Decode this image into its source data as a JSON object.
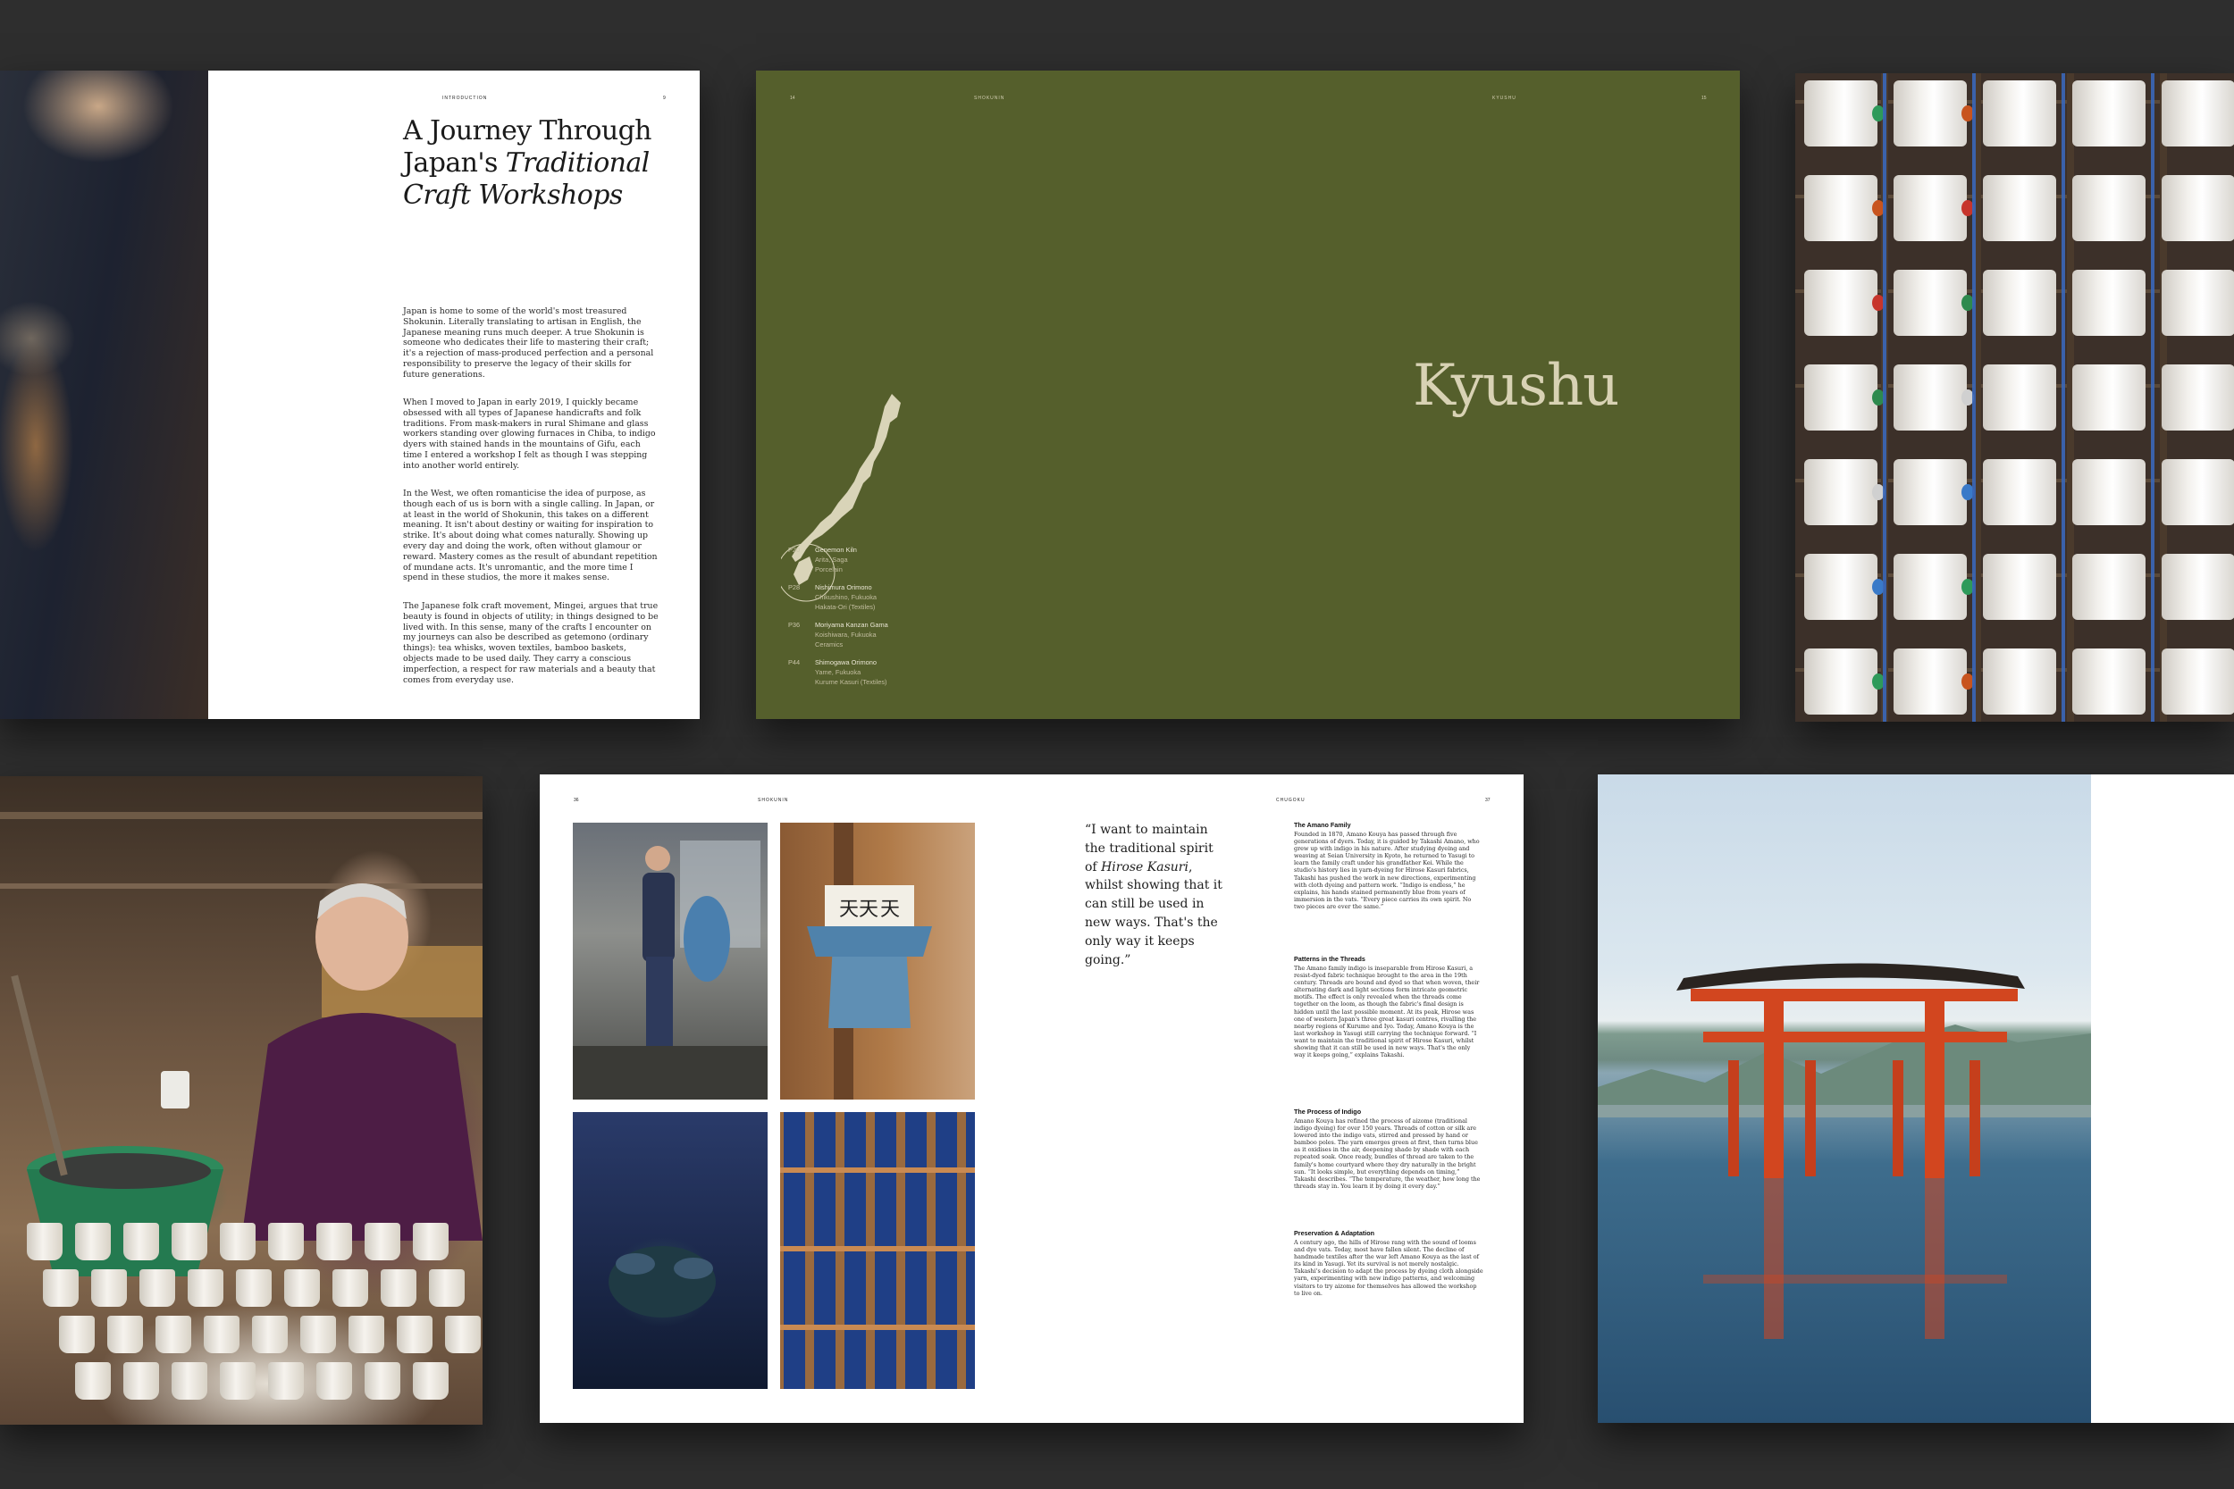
{
  "intro": {
    "running_head": "INTRODUCTION",
    "folio": "9",
    "title_line1": "A Journey Through",
    "title_line2a": "Japan's ",
    "title_line2b": "Traditional",
    "title_line3": "Craft Workshops",
    "paragraphs": [
      "Japan is home to some of the world's most treasured Shokunin. Literally translating to artisan in English, the Japanese meaning runs much deeper. A true Shokunin is someone who dedicates their life to mastering their craft; it's a rejection of mass-produced perfection and a personal responsibility to preserve the legacy of their skills for future generations.",
      "When I moved to Japan in early 2019, I quickly became obsessed with all types of Japanese handicrafts and folk traditions. From mask-makers in rural Shimane and glass workers standing over glowing furnaces in Chiba, to indigo dyers with stained hands in the mountains of Gifu, each time I entered a workshop I felt as though I was stepping into another world entirely.",
      "In the West, we often romanticise the idea of purpose, as though each of us is born with a single calling. In Japan, or at least in the world of Shokunin, this takes on a different meaning. It isn't about destiny or waiting for inspiration to strike. It's about doing what comes naturally. Showing up every day and doing the work, often without glamour or reward. Mastery comes as the result of abundant repetition of mundane acts. It's unromantic, and the more time I spend in these studios, the more it makes sense.",
      "The Japanese folk craft movement, Mingei, argues that true beauty is found in objects of utility; in things designed to be lived with. In this sense, many of the crafts I encounter on my journeys can also be described as getemono (ordinary things): tea whisks, woven textiles, bamboo baskets, objects made to be used daily. They carry a conscious imperfection, a respect for raw materials and a beauty that comes from everyday use."
    ]
  },
  "kyushu": {
    "folio_left": "14",
    "running_head_left": "SHOKUNIN",
    "running_head_right": "KYUSHU",
    "folio_right": "15",
    "title": "Kyushu",
    "toc": [
      {
        "page": "P20",
        "name": "Genemon Kiln",
        "location": "Arita, Saga",
        "category": "Porcelain"
      },
      {
        "page": "P28",
        "name": "Nishimura Orimono",
        "location": "Chikushino, Fukuoka",
        "category": "Hakata-Ori (Textiles)"
      },
      {
        "page": "P36",
        "name": "Moriyama Kanzan Gama",
        "location": "Koishiwara, Fukuoka",
        "category": "Ceramics"
      },
      {
        "page": "P44",
        "name": "Shimogawa Orimono",
        "location": "Yame, Fukuoka",
        "category": "Kurume Kasuri (Textiles)"
      }
    ],
    "map_color": "#d9d4b8"
  },
  "chugoku": {
    "folio_left": "36",
    "running_head_left": "SHOKUNIN",
    "running_head_right": "CHUGOKU",
    "folio_right": "37",
    "quote_part1": "“I want to maintain the traditional spirit of ",
    "quote_em": "Hirose Kasuri",
    "quote_part2": ", whilst showing that it can still be used in new ways. That's the only way it keeps going.”",
    "noren_glyph": "天",
    "sections": [
      {
        "heading": "The Amano Family",
        "body": "Founded in 1870, Amano Kouya has passed through five generations of dyers. Today, it is guided by Takashi Amano, who grew up with indigo in his nature. After studying dyeing and weaving at Seian University in Kyoto, he returned to Yasugi to learn the family craft under his grandfather Kei. While the studio's history lies in yarn-dyeing for Hirose Kasuri fabrics, Takashi has pushed the work in new directions, experimenting with cloth dyeing and pattern work. “Indigo is endless,” he explains, his hands stained permanently blue from years of immersion in the vats. “Every piece carries its own spirit. No two pieces are ever the same.”"
      },
      {
        "heading": "Patterns in the Threads",
        "body": "The Amano family indigo is inseparable from Hirose Kasuri, a resist-dyed fabric technique brought to the area in the 19th century. Threads are bound and dyed so that when woven, their alternating dark and light sections form intricate geometric motifs. The effect is only revealed when the threads come together on the loom, as though the fabric's final design is hidden until the last possible moment. At its peak, Hirose was one of western Japan's three great kasuri centres, rivalling the nearby regions of Kurume and Iyo. Today, Amano Kouya is the last workshop in Yasugi still carrying the technique forward. “I want to maintain the traditional spirit of Hirose Kasuri, whilst showing that it can still be used in new ways. That's the only way it keeps going,” explains Takashi."
      },
      {
        "heading": "The Process of Indigo",
        "body": "Amano Kouya has refined the process of aizome (traditional indigo dyeing) for over 150 years. Threads of cotton or silk are lowered into the indigo vats, stirred and pressed by hand or bamboo poles. The yarn emerges green at first, then turns blue as it oxidises in the air, deepening shade by shade with each repeated soak. Once ready, bundles of thread are taken to the family's home courtyard where they dry naturally in the bright sun. “It looks simple, but everything depends on timing,” Takashi describes. “The temperature, the weather, how long the threads stay in. You learn it by doing it every day.”"
      },
      {
        "heading": "Preservation & Adaptation",
        "body": "A century ago, the hills of Hirose rang with the sound of looms and dye vats. Today, most have fallen silent. The decline of handmade textiles after the war left Amano Kouya as the last of its kind in Yasugi. Yet its survival is not merely nostalgic. Takashi's decision to adapt the process by dyeing cloth alongside yarn, experimenting with new indigo patterns, and welcoming visitors to try aizome for themselves has allowed the workshop to live on."
      }
    ]
  },
  "colors": {
    "background": "#2e2e2e",
    "olive": "#555f2c",
    "torii_red": "#d2461f"
  }
}
